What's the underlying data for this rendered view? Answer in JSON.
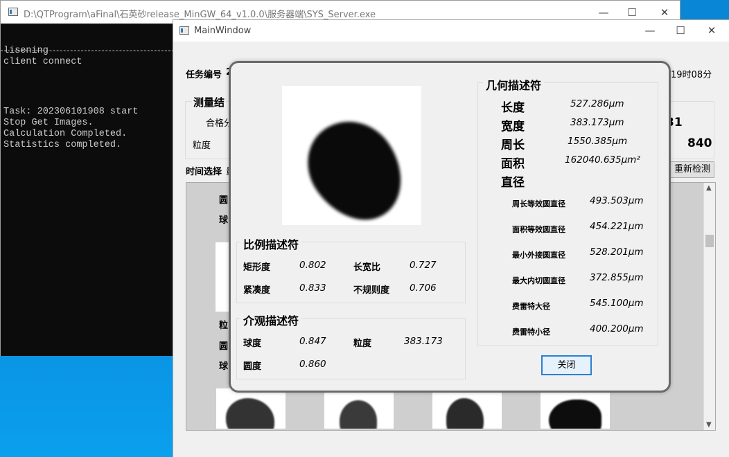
{
  "console": {
    "title": "D:\\QTProgram\\aFinal\\石英砂release_MinGW_64_v1.0.0\\服务器端\\SYS_Server.exe",
    "lines_top": "lisening\nclient connect",
    "lines_bottom": "Task: 202306101908 start\nStop Get Images.\nCalculation Completed.\nStatistics completed.",
    "min": "—",
    "max": "☐",
    "close": "✕"
  },
  "main": {
    "title": "MainWindow",
    "task_label": "任务编号",
    "task_value_partial": "2",
    "time_partial": "19时08分",
    "measure_group_partial": "测量结",
    "qualified_partial": "合格分",
    "granularity": "粒度",
    "count_partial": "31",
    "count_value": "840",
    "time_select": "时间选择",
    "time_select_partial": "量",
    "redetect_partial": "重新检测",
    "list_labels": [
      "圆",
      "球",
      "粒",
      "圆",
      "球"
    ],
    "min": "—",
    "max": "☐",
    "close": "✕"
  },
  "dialog": {
    "geometric_title": "几何描述符",
    "length_label": "长度",
    "length_value": "527.286μm",
    "width_label": "宽度",
    "width_value": "383.173μm",
    "perimeter_label": "周长",
    "perimeter_value": "1550.385μm",
    "area_label": "面积",
    "area_value": "162040.635μm²",
    "diameter_label": "直径",
    "diameters": [
      {
        "label": "周长等效圆直径",
        "value": "493.503μm"
      },
      {
        "label": "面积等效圆直径",
        "value": "454.221μm"
      },
      {
        "label": "最小外接圆直径",
        "value": "528.201μm"
      },
      {
        "label": "最大内切圆直径",
        "value": "372.855μm"
      },
      {
        "label": "费雷特大径",
        "value": "545.100μm"
      },
      {
        "label": "费雷特小径",
        "value": "400.200μm"
      }
    ],
    "ratio_title": "比例描述符",
    "rectangularity_label": "矩形度",
    "rectangularity_value": "0.802",
    "aspect_label": "长宽比",
    "aspect_value": "0.727",
    "compactness_label": "紧凑度",
    "compactness_value": "0.833",
    "irregularity_label": "不规则度",
    "irregularity_value": "0.706",
    "meso_title": "介观描述符",
    "sphericity_label": "球度",
    "sphericity_value": "0.847",
    "granularity_label": "粒度",
    "granularity_value": "383.173",
    "roundness_label": "圆度",
    "roundness_value": "0.860",
    "close_button": "关闭"
  }
}
